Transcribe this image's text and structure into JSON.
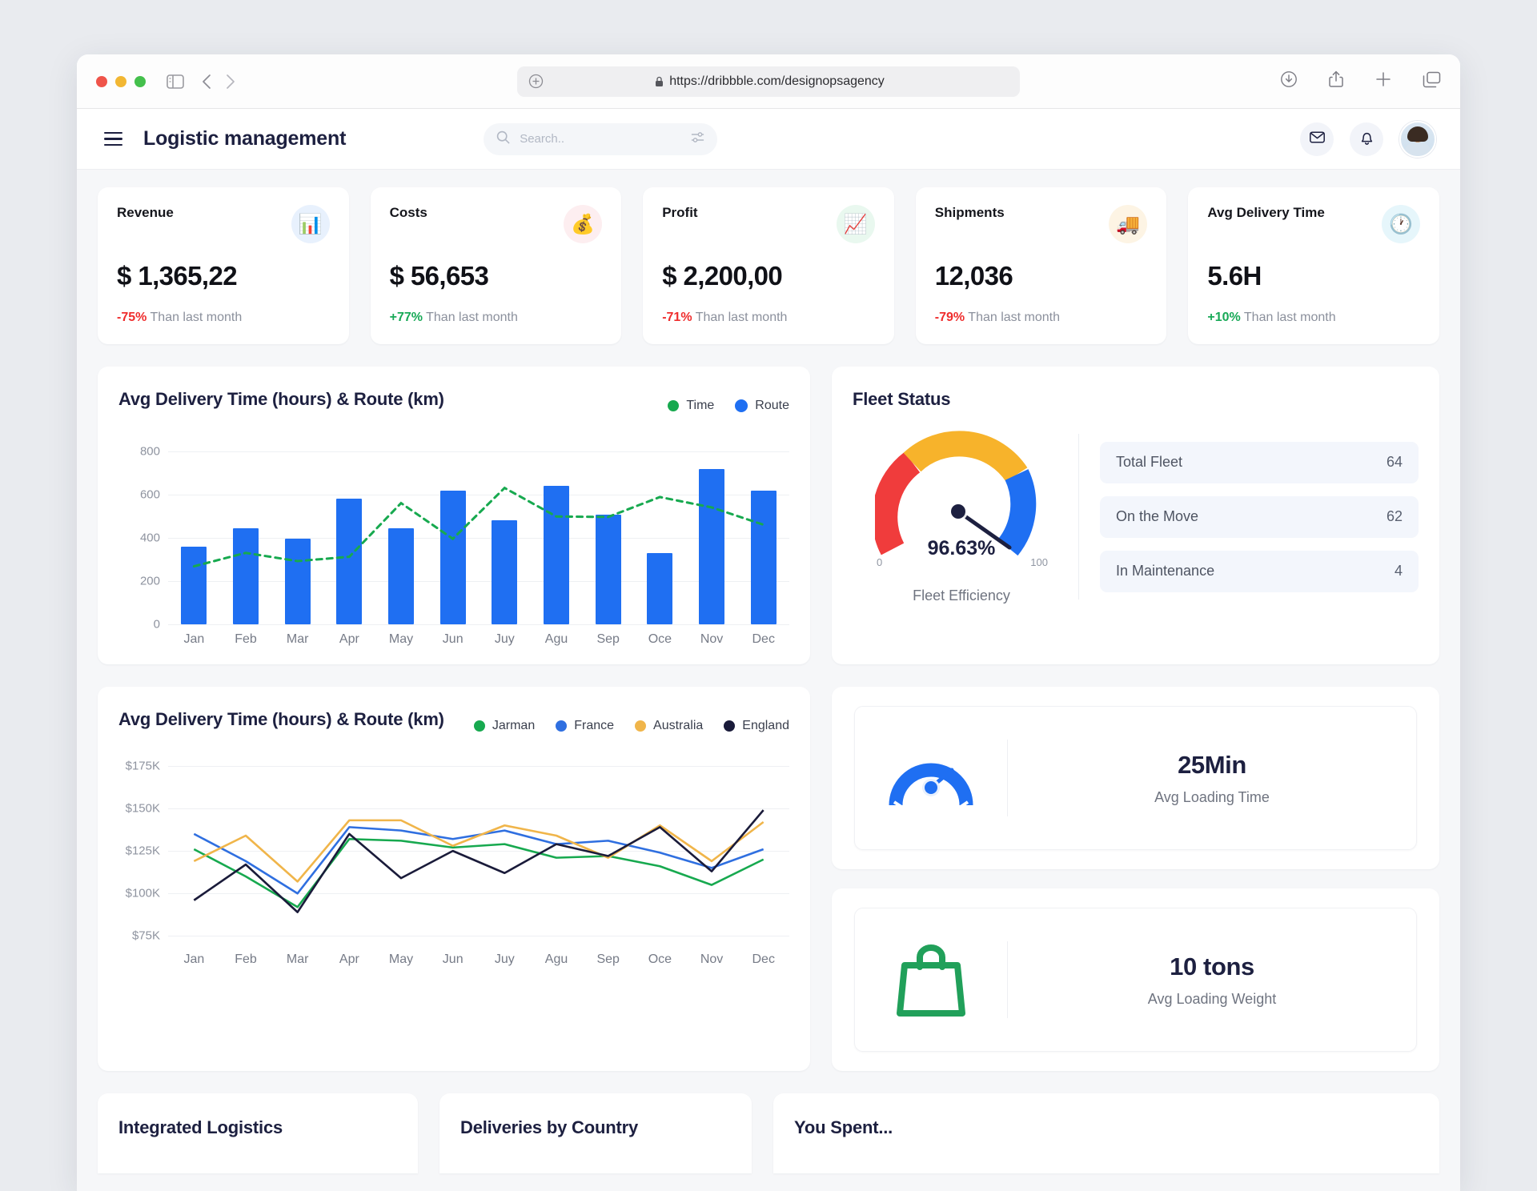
{
  "browser": {
    "url": "https://dribbble.com/designopsagency",
    "lock_icon": "lock-icon",
    "new_tab_icon": "plus-circle-icon",
    "back_icon": "chevron-left-icon",
    "forward_icon": "chevron-right-icon",
    "sidebar_icon": "sidebar-toggle-icon",
    "download_icon": "download-icon",
    "share_icon": "share-icon",
    "add_tab_icon": "plus-icon",
    "tabs_icon": "tabs-overview-icon"
  },
  "header": {
    "menu_icon": "hamburger-menu-icon",
    "title": "Logistic management",
    "search": {
      "placeholder": "Search..",
      "value": "",
      "icon": "search-icon",
      "filter_icon": "filter-sliders-icon"
    },
    "mail_icon": "mail-icon",
    "bell_icon": "bell-icon",
    "avatar": "user-avatar"
  },
  "kpis": [
    {
      "label": "Revenue",
      "value": "$ 1,365,22",
      "delta": "-75%",
      "delta_dir": "down",
      "delta_text": "Than last month",
      "icon": "bar-chart-money-icon",
      "icon_bg": "#e8f1fd"
    },
    {
      "label": "Costs",
      "value": "$ 56,653",
      "delta": "+77%",
      "delta_dir": "up",
      "delta_text": "Than last month",
      "icon": "money-bag-icon",
      "icon_bg": "#fdeef0"
    },
    {
      "label": "Profit",
      "value": "$ 2,200,00",
      "delta": "-71%",
      "delta_dir": "down",
      "delta_text": "Than last month",
      "icon": "growth-arrow-coin-icon",
      "icon_bg": "#e9f8ef"
    },
    {
      "label": "Shipments",
      "value": "12,036",
      "delta": "-79%",
      "delta_dir": "down",
      "delta_text": "Than last month",
      "icon": "delivery-truck-pin-icon",
      "icon_bg": "#fdf4e4"
    },
    {
      "label": "Avg Delivery Time",
      "value": "5.6H",
      "delta": "+10%",
      "delta_dir": "up",
      "delta_text": "Than last month",
      "icon": "clock-24h-icon",
      "icon_bg": "#e6f6fb"
    }
  ],
  "fleet": {
    "title": "Fleet Status",
    "gauge_value": "96.63%",
    "gauge_min": "0",
    "gauge_max": "100",
    "caption": "Fleet Efficiency",
    "rows": [
      {
        "label": "Total Fleet",
        "value": "64"
      },
      {
        "label": "On the Move",
        "value": "62"
      },
      {
        "label": "In Maintenance",
        "value": "4"
      }
    ]
  },
  "side_cards": [
    {
      "icon": "speedometer-icon",
      "value": "25Min",
      "label": "Avg Loading Time",
      "color": "#1f6ff2"
    },
    {
      "icon": "shopping-bag-icon",
      "value": "10 tons",
      "label": "Avg Loading Weight",
      "color": "#21a05a"
    }
  ],
  "bottom_cards": [
    {
      "title": "Integrated Logistics"
    },
    {
      "title": "Deliveries by Country"
    },
    {
      "title": "You Spent..."
    }
  ],
  "chart_data": [
    {
      "type": "bar",
      "title": "Avg Delivery Time (hours) & Route (km)",
      "categories": [
        "Jan",
        "Feb",
        "Mar",
        "Apr",
        "May",
        "Jun",
        "Juy",
        "Agu",
        "Sep",
        "Oce",
        "Nov",
        "Dec"
      ],
      "ylabel": "",
      "xlabel": "",
      "ylim": [
        0,
        880
      ],
      "yticks": [
        0,
        200,
        400,
        600,
        800
      ],
      "ytick_labels": [
        "0",
        "200",
        "400",
        "600",
        "800"
      ],
      "grid": true,
      "legend": [
        {
          "name": "Time",
          "color": "#17a94f"
        },
        {
          "name": "Route",
          "color": "#1f6ff2"
        }
      ],
      "series": [
        {
          "name": "Route",
          "type": "bar",
          "color": "#1f6ff2",
          "values": [
            360,
            445,
            395,
            580,
            445,
            618,
            480,
            638,
            508,
            330,
            718,
            618
          ]
        },
        {
          "name": "Time",
          "type": "line-dashed",
          "color": "#17a94f",
          "values": [
            268,
            330,
            292,
            312,
            560,
            395,
            630,
            498,
            496,
            588,
            540,
            460
          ]
        }
      ]
    },
    {
      "type": "line",
      "title": "Avg Delivery Time (hours) & Route (km)",
      "categories": [
        "Jan",
        "Feb",
        "Mar",
        "Apr",
        "May",
        "Jun",
        "Juy",
        "Agu",
        "Sep",
        "Oce",
        "Nov",
        "Dec"
      ],
      "ylim": [
        70000,
        182000
      ],
      "yticks": [
        75000,
        100000,
        125000,
        150000,
        175000
      ],
      "ytick_labels": [
        "$75K",
        "$100K",
        "$125K",
        "$150K",
        "$175K"
      ],
      "grid": true,
      "legend_position": "top-right",
      "series": [
        {
          "name": "Jarman",
          "color": "#17a94f",
          "values": [
            126000,
            110000,
            92000,
            132000,
            131000,
            127000,
            129000,
            121000,
            122000,
            116000,
            105000,
            120000
          ]
        },
        {
          "name": "France",
          "color": "#2f6fe0",
          "values": [
            135000,
            119000,
            100000,
            139000,
            137000,
            132000,
            137000,
            129000,
            131000,
            124000,
            115000,
            126000
          ]
        },
        {
          "name": "Australia",
          "color": "#f0b54a",
          "values": [
            119000,
            134000,
            107000,
            143000,
            143000,
            128000,
            140000,
            134000,
            121000,
            140000,
            119000,
            142000
          ]
        },
        {
          "name": "England",
          "color": "#1a1b3a",
          "values": [
            96000,
            117000,
            89000,
            135000,
            109000,
            125000,
            112000,
            129000,
            122000,
            139000,
            113000,
            149000
          ]
        }
      ]
    }
  ]
}
